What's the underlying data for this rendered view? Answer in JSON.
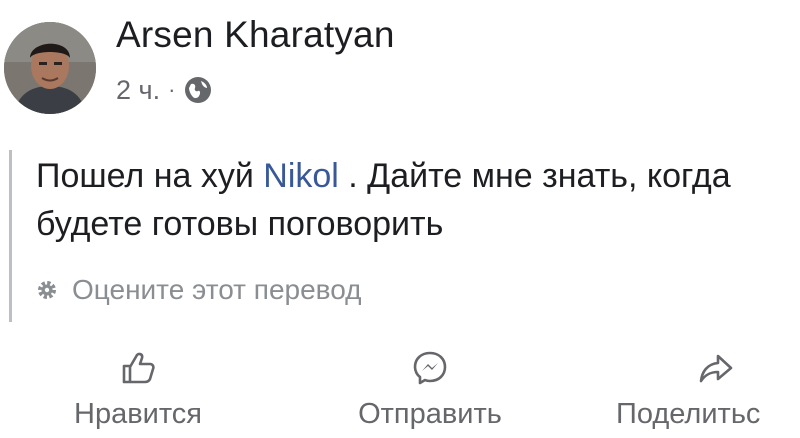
{
  "post": {
    "author": "Arsen Kharatyan",
    "time": "2 ч.",
    "separator": "·",
    "privacy_icon": "globe-icon",
    "body_part1": "Пошел на хуй ",
    "body_mention": "Nikol",
    "body_part2": " . Дайте мне знать, когда будете готовы поговорить",
    "translate_label": "Оцените этот перевод",
    "colors": {
      "mention": "#385898",
      "secondary": "#65676b"
    }
  },
  "actions": {
    "like_label": "Нравится",
    "send_label": "Отправить",
    "share_label": "Поделитьс"
  }
}
